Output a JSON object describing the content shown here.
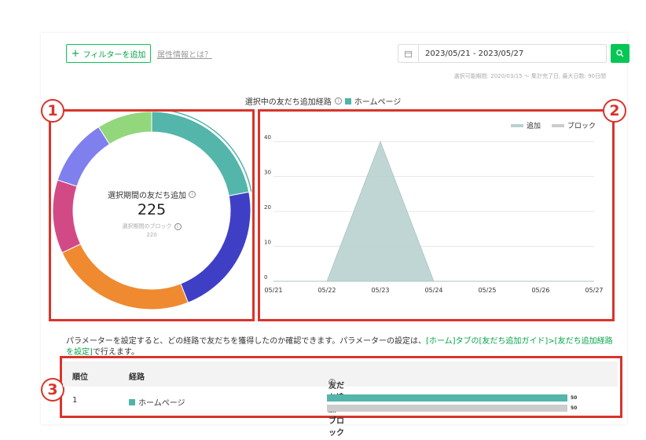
{
  "toolbar": {
    "add_filter_label": "フィルターを追加",
    "attribute_link": "属性情報とは？",
    "date_range": "2023/05/21 - 2023/05/27",
    "period_note": "選択可能期間: 2020/03/15 〜 集計完了日, 最大日数: 90日間"
  },
  "route_title": "選択中の友だち追加経路",
  "route_selected": "ホームページ",
  "badges": [
    "1",
    "2",
    "3"
  ],
  "donut": {
    "label": "選択期間の友だち追加",
    "count": "225",
    "block_label": "選択期間のブロック",
    "block_count": "220",
    "segments": [
      {
        "color": "#54b5aa",
        "fraction": 0.22
      },
      {
        "color": "#3f3fc6",
        "fraction": 0.22
      },
      {
        "color": "#ef8a30",
        "fraction": 0.24
      },
      {
        "color": "#d24a85",
        "fraction": 0.12
      },
      {
        "color": "#7f7fed",
        "fraction": 0.11
      },
      {
        "color": "#92d77b",
        "fraction": 0.09
      }
    ]
  },
  "legend": {
    "add_label": "追加",
    "block_label": "ブロック"
  },
  "chart_data": {
    "type": "area",
    "x": [
      "05/21",
      "05/22",
      "05/23",
      "05/24",
      "05/25",
      "05/26",
      "05/27"
    ],
    "y_ticks": [
      "0",
      "10",
      "20",
      "30",
      "40"
    ],
    "ylim": [
      0,
      45
    ],
    "grid": true,
    "legend_position": "top-right",
    "series": [
      {
        "name": "追加",
        "color": "#b9d2d0",
        "values": [
          0,
          0,
          40,
          0,
          0,
          0,
          0
        ]
      },
      {
        "name": "ブロック",
        "color": "#cccccc",
        "values": [
          0,
          0,
          0,
          0,
          0,
          0,
          0
        ]
      }
    ]
  },
  "paragraph": {
    "text": "パラメーターを設定すると、どの経路で友だちを獲得したのか確認できます。パラメーターの設定は、",
    "link": "[ホーム]タブの[友だち追加ガイド]>[友だち追加経路を設定]",
    "suffix": "で行えます。"
  },
  "table": {
    "headers": {
      "rank": "順位",
      "route": "経路",
      "add_block": "友だち追加・ブロック"
    },
    "rows": [
      {
        "rank": "1",
        "route": "ホームページ",
        "add_value": "50",
        "block_value": "50",
        "add_fraction": 1.0,
        "block_fraction": 1.0,
        "add_color": "#54b5aa",
        "block_color": "#cccccc"
      }
    ]
  }
}
